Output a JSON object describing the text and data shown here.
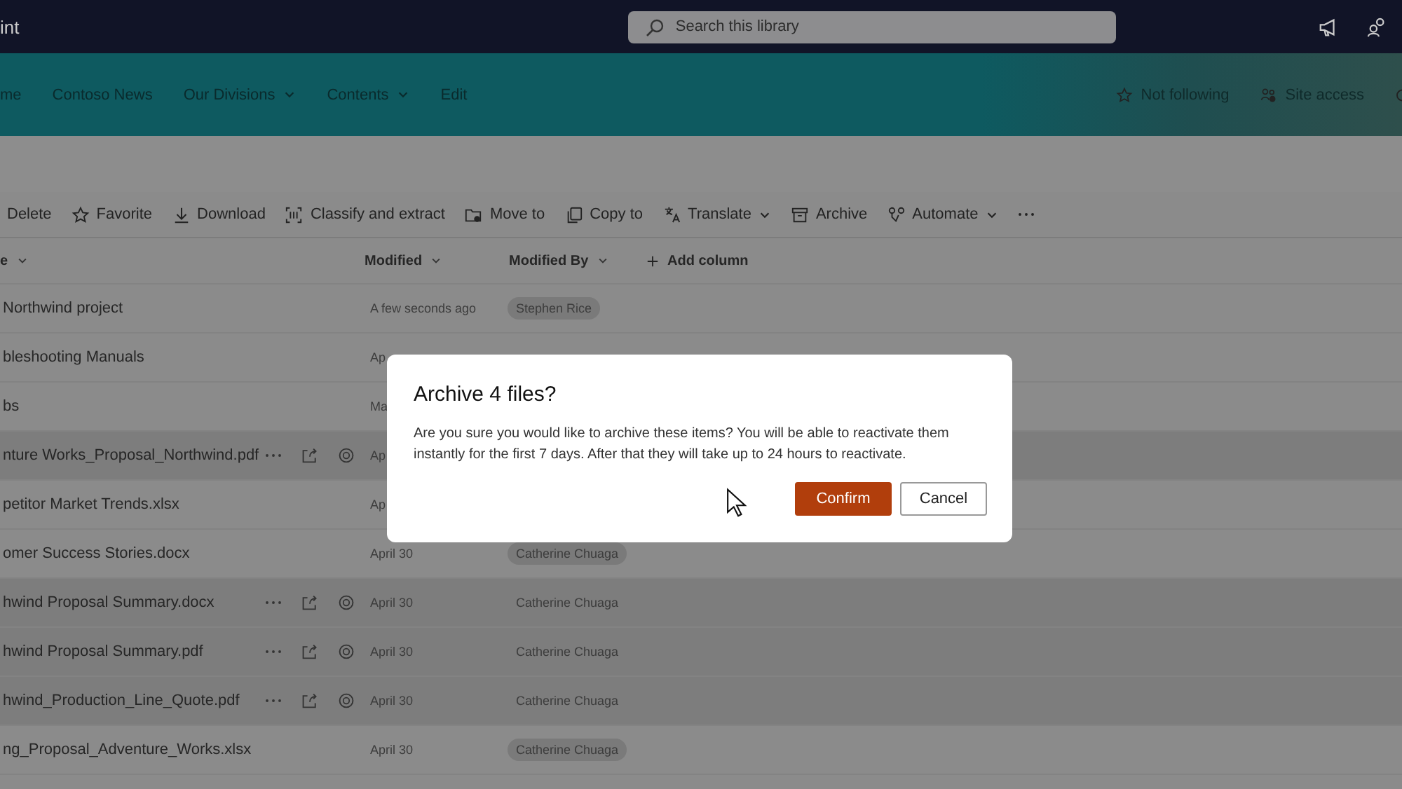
{
  "app_bar": {
    "title": "int",
    "search": {
      "placeholder": "Search this library"
    }
  },
  "site_nav": [
    {
      "label": "me",
      "dropdown": false
    },
    {
      "label": "Contoso News",
      "dropdown": false
    },
    {
      "label": "Our Divisions",
      "dropdown": true
    },
    {
      "label": "Contents",
      "dropdown": true
    },
    {
      "label": "Edit",
      "dropdown": false
    }
  ],
  "site_actions": [
    {
      "label": "Not following",
      "kind": "follow"
    },
    {
      "label": "Site access",
      "kind": "access"
    }
  ],
  "commands": [
    {
      "label": "Delete",
      "kind": "plain",
      "dropdown": false
    },
    {
      "label": "Favorite",
      "kind": "favorite",
      "dropdown": false
    },
    {
      "label": "Download",
      "kind": "download",
      "dropdown": false
    },
    {
      "label": "Classify and extract",
      "kind": "classify",
      "dropdown": false
    },
    {
      "label": "Move to",
      "kind": "move",
      "dropdown": false
    },
    {
      "label": "Copy to",
      "kind": "copy",
      "dropdown": false
    },
    {
      "label": "Translate",
      "kind": "translate",
      "dropdown": true
    },
    {
      "label": "Archive",
      "kind": "archive",
      "dropdown": false
    },
    {
      "label": "Automate",
      "kind": "automate",
      "dropdown": true
    }
  ],
  "columns": [
    {
      "label": "e",
      "add": false
    },
    {
      "label": "Modified",
      "add": false
    },
    {
      "label": "Modified By",
      "add": false
    },
    {
      "label": "Add column",
      "add": true
    }
  ],
  "rows": [
    {
      "name": "Northwind project",
      "selected": false,
      "modified": "A few seconds ago",
      "modified_by": "Stephen Rice"
    },
    {
      "name": "bleshooting Manuals",
      "selected": false,
      "modified": "Ap"
    },
    {
      "name": "bs",
      "selected": false,
      "modified": "Ma"
    },
    {
      "name": "nture Works_Proposal_Northwind.pdf",
      "selected": true,
      "modified": "Ap"
    },
    {
      "name": "petitor Market Trends.xlsx",
      "selected": false,
      "modified": "Ap"
    },
    {
      "name": "omer Success Stories.docx",
      "selected": false,
      "modified": "April 30",
      "modified_by": "Catherine Chuaga"
    },
    {
      "name": "hwind Proposal Summary.docx",
      "selected": true,
      "modified": "April 30",
      "modified_by": "Catherine Chuaga"
    },
    {
      "name": "hwind Proposal Summary.pdf",
      "selected": true,
      "modified": "April 30",
      "modified_by": "Catherine Chuaga"
    },
    {
      "name": "hwind_Production_Line_Quote.pdf",
      "selected": true,
      "modified": "April 30",
      "modified_by": "Catherine Chuaga"
    },
    {
      "name": "ng_Proposal_Adventure_Works.xlsx",
      "selected": false,
      "modified": "April 30",
      "modified_by": "Catherine Chuaga"
    }
  ],
  "dialog": {
    "title": "Archive 4 files?",
    "body": "Are you sure you would like to archive these items? You will be able to reactivate them instantly for the first 7 days. After that they will take up to 24 hours to reactivate.",
    "buttons": [
      {
        "label": "Confirm",
        "kind": "primary"
      },
      {
        "label": "Cancel",
        "kind": "secondary"
      }
    ]
  }
}
